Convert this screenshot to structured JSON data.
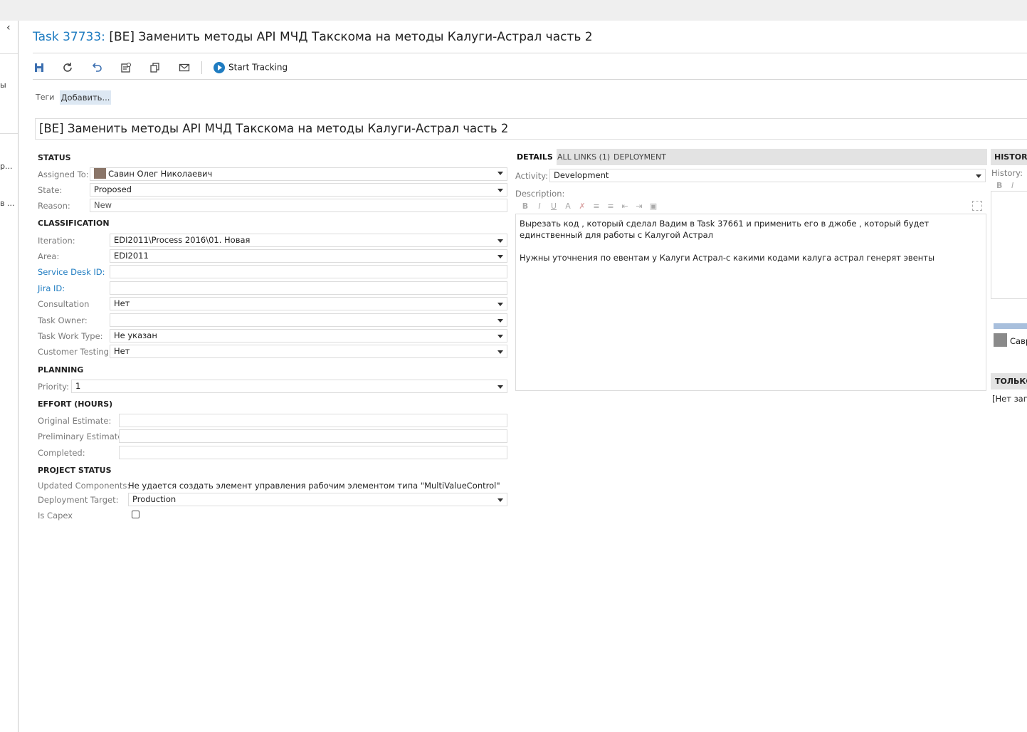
{
  "header": {
    "task_ref": "Task 37733:",
    "task_title": "[BE] Заменить методы API МЧД Такскома на методы Калуги-Астрал часть 2"
  },
  "left_panel": {
    "fragments": [
      "ы",
      "р...",
      "в ..."
    ]
  },
  "toolbar": {
    "start_tracking": "Start Tracking"
  },
  "tags": {
    "label": "Теги",
    "add_button": "Добавить..."
  },
  "title_field": "[BE] Заменить методы API МЧД Такскома на методы Калуги-Астрал часть 2",
  "status": {
    "heading": "STATUS",
    "assigned_to_label": "Assigned To:",
    "assigned_to": "Савин Олег Николаевич",
    "state_label": "State:",
    "state": "Proposed",
    "reason_label": "Reason:",
    "reason": "New"
  },
  "classification": {
    "heading": "CLASSIFICATION",
    "iteration_label": "Iteration:",
    "iteration": "EDI2011\\Process 2016\\01. Новая",
    "area_label": "Area:",
    "area": "EDI2011",
    "service_desk_label": "Service Desk ID:",
    "service_desk": "",
    "jira_label": "Jira ID:",
    "jira": "",
    "consultation_label": "Consultation",
    "consultation": "Нет",
    "task_owner_label": "Task Owner:",
    "task_owner": "",
    "task_work_type_label": "Task Work Type:",
    "task_work_type": "Не указан",
    "customer_testing_label": "Customer Testing:",
    "customer_testing": "Нет"
  },
  "planning": {
    "heading": "PLANNING",
    "priority_label": "Priority:",
    "priority": "1"
  },
  "effort": {
    "heading": "EFFORT (HOURS)",
    "original_label": "Original Estimate:",
    "preliminary_label": "Preliminary Estimate",
    "completed_label": "Completed:"
  },
  "project_status": {
    "heading": "PROJECT STATUS",
    "updated_components_label": "Updated Components:",
    "updated_components": "Не удается создать элемент управления рабочим элементом типа \"MultiValueControl\"",
    "deployment_target_label": "Deployment Target:",
    "deployment_target": "Production",
    "is_capex_label": "Is Capex"
  },
  "details": {
    "tabs": [
      "DETAILS",
      "ALL LINKS (1)",
      "DEPLOYMENT"
    ],
    "activity_label": "Activity:",
    "activity": "Development",
    "description_label": "Description:",
    "description_lines": [
      "Вырезать код , который сделал Вадим в Task 37661 и применить его в джобе , который будет единственный для работы с Калугой Астрал",
      "Нужны уточнения по евентам у Калуги Астрал-с какими кодами калуга астрал генерят эвенты"
    ],
    "rte_tools": [
      "B",
      "I",
      "U",
      "A",
      "✗",
      "≡",
      "≡",
      "⇤",
      "⇥",
      "▣"
    ]
  },
  "history": {
    "tab": "HISTORY",
    "label": "History:",
    "rte_b": "B",
    "rte_i": "I",
    "user_fragment": "Савр",
    "only_tab": "ТОЛЬКО",
    "no_records": "[Нет запи"
  }
}
